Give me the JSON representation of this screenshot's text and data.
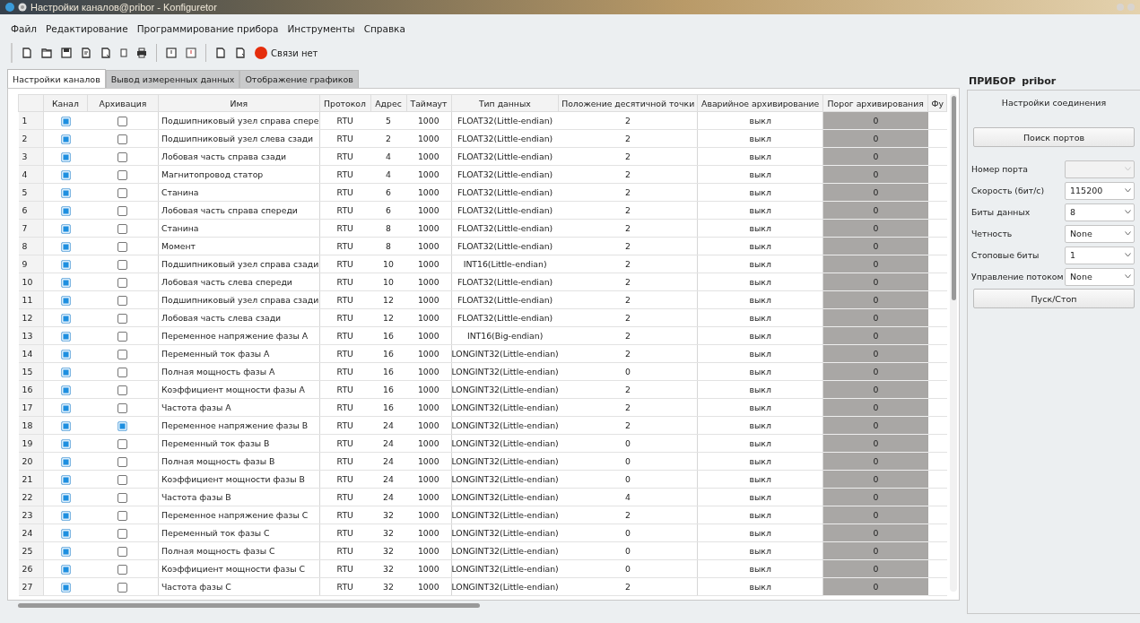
{
  "window": {
    "title": "Настройки каналов@pribor - Konfiguretor"
  },
  "menu": [
    "Файл",
    "Редактирование",
    "Программирование прибора",
    "Инструменты",
    "Справка"
  ],
  "connection": {
    "text": "Связи нет",
    "connected": false
  },
  "tabs": [
    {
      "label": "Настройки каналов",
      "selected": true
    },
    {
      "label": "Вывод измеренных данных",
      "selected": false
    },
    {
      "label": "Отображение графиков",
      "selected": false
    }
  ],
  "table": {
    "columns": [
      "Канал",
      "Архивация",
      "Имя",
      "Протокол",
      "Адрес",
      "Таймаут",
      "Тип данных",
      "Положение десятичной точки",
      "Аварийное архивирование",
      "Порог архивирования",
      "Фу"
    ],
    "rows": [
      {
        "number": "1",
        "channel": true,
        "archive": false,
        "name": "Подшипниковый узел справа спере",
        "protocol": "RTU",
        "address": "5",
        "timeout": "1000",
        "data_type": "FLOAT32(Little-endian)",
        "decimal_point": "2",
        "emergency_archive": "выкл",
        "threshold": "0"
      },
      {
        "number": "2",
        "channel": true,
        "archive": false,
        "name": "Подшипниковый узел слева сзади",
        "protocol": "RTU",
        "address": "2",
        "timeout": "1000",
        "data_type": "FLOAT32(Little-endian)",
        "decimal_point": "2",
        "emergency_archive": "выкл",
        "threshold": "0"
      },
      {
        "number": "3",
        "channel": true,
        "archive": false,
        "name": "Лобовая часть справа сзади",
        "protocol": "RTU",
        "address": "4",
        "timeout": "1000",
        "data_type": "FLOAT32(Little-endian)",
        "decimal_point": "2",
        "emergency_archive": "выкл",
        "threshold": "0"
      },
      {
        "number": "4",
        "channel": true,
        "archive": false,
        "name": "Магнитопровод статор",
        "protocol": "RTU",
        "address": "4",
        "timeout": "1000",
        "data_type": "FLOAT32(Little-endian)",
        "decimal_point": "2",
        "emergency_archive": "выкл",
        "threshold": "0"
      },
      {
        "number": "5",
        "channel": true,
        "archive": false,
        "name": "Станина",
        "protocol": "RTU",
        "address": "6",
        "timeout": "1000",
        "data_type": "FLOAT32(Little-endian)",
        "decimal_point": "2",
        "emergency_archive": "выкл",
        "threshold": "0"
      },
      {
        "number": "6",
        "channel": true,
        "archive": false,
        "name": "Лобовая часть справа спереди",
        "protocol": "RTU",
        "address": "6",
        "timeout": "1000",
        "data_type": "FLOAT32(Little-endian)",
        "decimal_point": "2",
        "emergency_archive": "выкл",
        "threshold": "0"
      },
      {
        "number": "7",
        "channel": true,
        "archive": false,
        "name": "Станина",
        "protocol": "RTU",
        "address": "8",
        "timeout": "1000",
        "data_type": "FLOAT32(Little-endian)",
        "decimal_point": "2",
        "emergency_archive": "выкл",
        "threshold": "0"
      },
      {
        "number": "8",
        "channel": true,
        "archive": false,
        "name": "Момент",
        "protocol": "RTU",
        "address": "8",
        "timeout": "1000",
        "data_type": "FLOAT32(Little-endian)",
        "decimal_point": "2",
        "emergency_archive": "выкл",
        "threshold": "0"
      },
      {
        "number": "9",
        "channel": true,
        "archive": false,
        "name": "Подшипниковый узел справа сзади",
        "protocol": "RTU",
        "address": "10",
        "timeout": "1000",
        "data_type": "INT16(Little-endian)",
        "decimal_point": "2",
        "emergency_archive": "выкл",
        "threshold": "0"
      },
      {
        "number": "10",
        "channel": true,
        "archive": false,
        "name": "Лобовая часть слева спереди",
        "protocol": "RTU",
        "address": "10",
        "timeout": "1000",
        "data_type": "FLOAT32(Little-endian)",
        "decimal_point": "2",
        "emergency_archive": "выкл",
        "threshold": "0"
      },
      {
        "number": "11",
        "channel": true,
        "archive": false,
        "name": "Подшипниковый узел справа сзади",
        "protocol": "RTU",
        "address": "12",
        "timeout": "1000",
        "data_type": "FLOAT32(Little-endian)",
        "decimal_point": "2",
        "emergency_archive": "выкл",
        "threshold": "0"
      },
      {
        "number": "12",
        "channel": true,
        "archive": false,
        "name": "Лобовая часть слева сзади",
        "protocol": "RTU",
        "address": "12",
        "timeout": "1000",
        "data_type": "FLOAT32(Little-endian)",
        "decimal_point": "2",
        "emergency_archive": "выкл",
        "threshold": "0"
      },
      {
        "number": "13",
        "channel": true,
        "archive": false,
        "name": "Переменное напряжение фазы A",
        "protocol": "RTU",
        "address": "16",
        "timeout": "1000",
        "data_type": "INT16(Big-endian)",
        "decimal_point": "2",
        "emergency_archive": "выкл",
        "threshold": "0"
      },
      {
        "number": "14",
        "channel": true,
        "archive": false,
        "name": "Переменный ток фазы A",
        "protocol": "RTU",
        "address": "16",
        "timeout": "1000",
        "data_type": "LONGINT32(Little-endian)",
        "decimal_point": "2",
        "emergency_archive": "выкл",
        "threshold": "0"
      },
      {
        "number": "15",
        "channel": true,
        "archive": false,
        "name": "Полная мощность фазы A",
        "protocol": "RTU",
        "address": "16",
        "timeout": "1000",
        "data_type": "LONGINT32(Little-endian)",
        "decimal_point": "0",
        "emergency_archive": "выкл",
        "threshold": "0"
      },
      {
        "number": "16",
        "channel": true,
        "archive": false,
        "name": "Коэффициент мощности фазы A",
        "protocol": "RTU",
        "address": "16",
        "timeout": "1000",
        "data_type": "LONGINT32(Little-endian)",
        "decimal_point": "2",
        "emergency_archive": "выкл",
        "threshold": "0"
      },
      {
        "number": "17",
        "channel": true,
        "archive": false,
        "name": "Частота фазы A",
        "protocol": "RTU",
        "address": "16",
        "timeout": "1000",
        "data_type": "LONGINT32(Little-endian)",
        "decimal_point": "2",
        "emergency_archive": "выкл",
        "threshold": "0"
      },
      {
        "number": "18",
        "channel": true,
        "archive": true,
        "name": "Переменное напряжение фазы B",
        "protocol": "RTU",
        "address": "24",
        "timeout": "1000",
        "data_type": "LONGINT32(Little-endian)",
        "decimal_point": "2",
        "emergency_archive": "выкл",
        "threshold": "0"
      },
      {
        "number": "19",
        "channel": true,
        "archive": false,
        "name": "Переменный ток фазы B",
        "protocol": "RTU",
        "address": "24",
        "timeout": "1000",
        "data_type": "LONGINT32(Little-endian)",
        "decimal_point": "0",
        "emergency_archive": "выкл",
        "threshold": "0"
      },
      {
        "number": "20",
        "channel": true,
        "archive": false,
        "name": "Полная мощность фазы B",
        "protocol": "RTU",
        "address": "24",
        "timeout": "1000",
        "data_type": "LONGINT32(Little-endian)",
        "decimal_point": "0",
        "emergency_archive": "выкл",
        "threshold": "0"
      },
      {
        "number": "21",
        "channel": true,
        "archive": false,
        "name": "Коэффициент мощности фазы B",
        "protocol": "RTU",
        "address": "24",
        "timeout": "1000",
        "data_type": "LONGINT32(Little-endian)",
        "decimal_point": "0",
        "emergency_archive": "выкл",
        "threshold": "0"
      },
      {
        "number": "22",
        "channel": true,
        "archive": false,
        "name": "Частота фазы B",
        "protocol": "RTU",
        "address": "24",
        "timeout": "1000",
        "data_type": "LONGINT32(Little-endian)",
        "decimal_point": "4",
        "emergency_archive": "выкл",
        "threshold": "0"
      },
      {
        "number": "23",
        "channel": true,
        "archive": false,
        "name": "Переменное напряжение фазы C",
        "protocol": "RTU",
        "address": "32",
        "timeout": "1000",
        "data_type": "LONGINT32(Little-endian)",
        "decimal_point": "2",
        "emergency_archive": "выкл",
        "threshold": "0"
      },
      {
        "number": "24",
        "channel": true,
        "archive": false,
        "name": "Переменный ток фазы C",
        "protocol": "RTU",
        "address": "32",
        "timeout": "1000",
        "data_type": "LONGINT32(Little-endian)",
        "decimal_point": "0",
        "emergency_archive": "выкл",
        "threshold": "0"
      },
      {
        "number": "25",
        "channel": true,
        "archive": false,
        "name": "Полная мощность фазы C",
        "protocol": "RTU",
        "address": "32",
        "timeout": "1000",
        "data_type": "LONGINT32(Little-endian)",
        "decimal_point": "0",
        "emergency_archive": "выкл",
        "threshold": "0"
      },
      {
        "number": "26",
        "channel": true,
        "archive": false,
        "name": "Коэффициент мощности фазы C",
        "protocol": "RTU",
        "address": "32",
        "timeout": "1000",
        "data_type": "LONGINT32(Little-endian)",
        "decimal_point": "0",
        "emergency_archive": "выкл",
        "threshold": "0"
      },
      {
        "number": "27",
        "channel": true,
        "archive": false,
        "name": "Частота фазы C",
        "protocol": "RTU",
        "address": "32",
        "timeout": "1000",
        "data_type": "LONGINT32(Little-endian)",
        "decimal_point": "2",
        "emergency_archive": "выкл",
        "threshold": "0"
      }
    ]
  },
  "device": {
    "label": "ПРИБОР",
    "name": "pribor"
  },
  "connection_settings": {
    "title": "Настройки соединения",
    "search_button": "Поиск портов",
    "fields": [
      {
        "label": "Номер порта",
        "disabled": true
      },
      {
        "label": "Скорость (бит/с)",
        "value": "115200",
        "disabled": false
      },
      {
        "label": "Биты данных",
        "value": "8",
        "disabled": false
      },
      {
        "label": "Четность",
        "value": "None",
        "disabled": false
      },
      {
        "label": "Стоповые биты",
        "value": "1",
        "disabled": false
      },
      {
        "label": "Управление потоком",
        "value": "None",
        "disabled": false
      }
    ],
    "start_button": "Пуск/Стоп"
  }
}
